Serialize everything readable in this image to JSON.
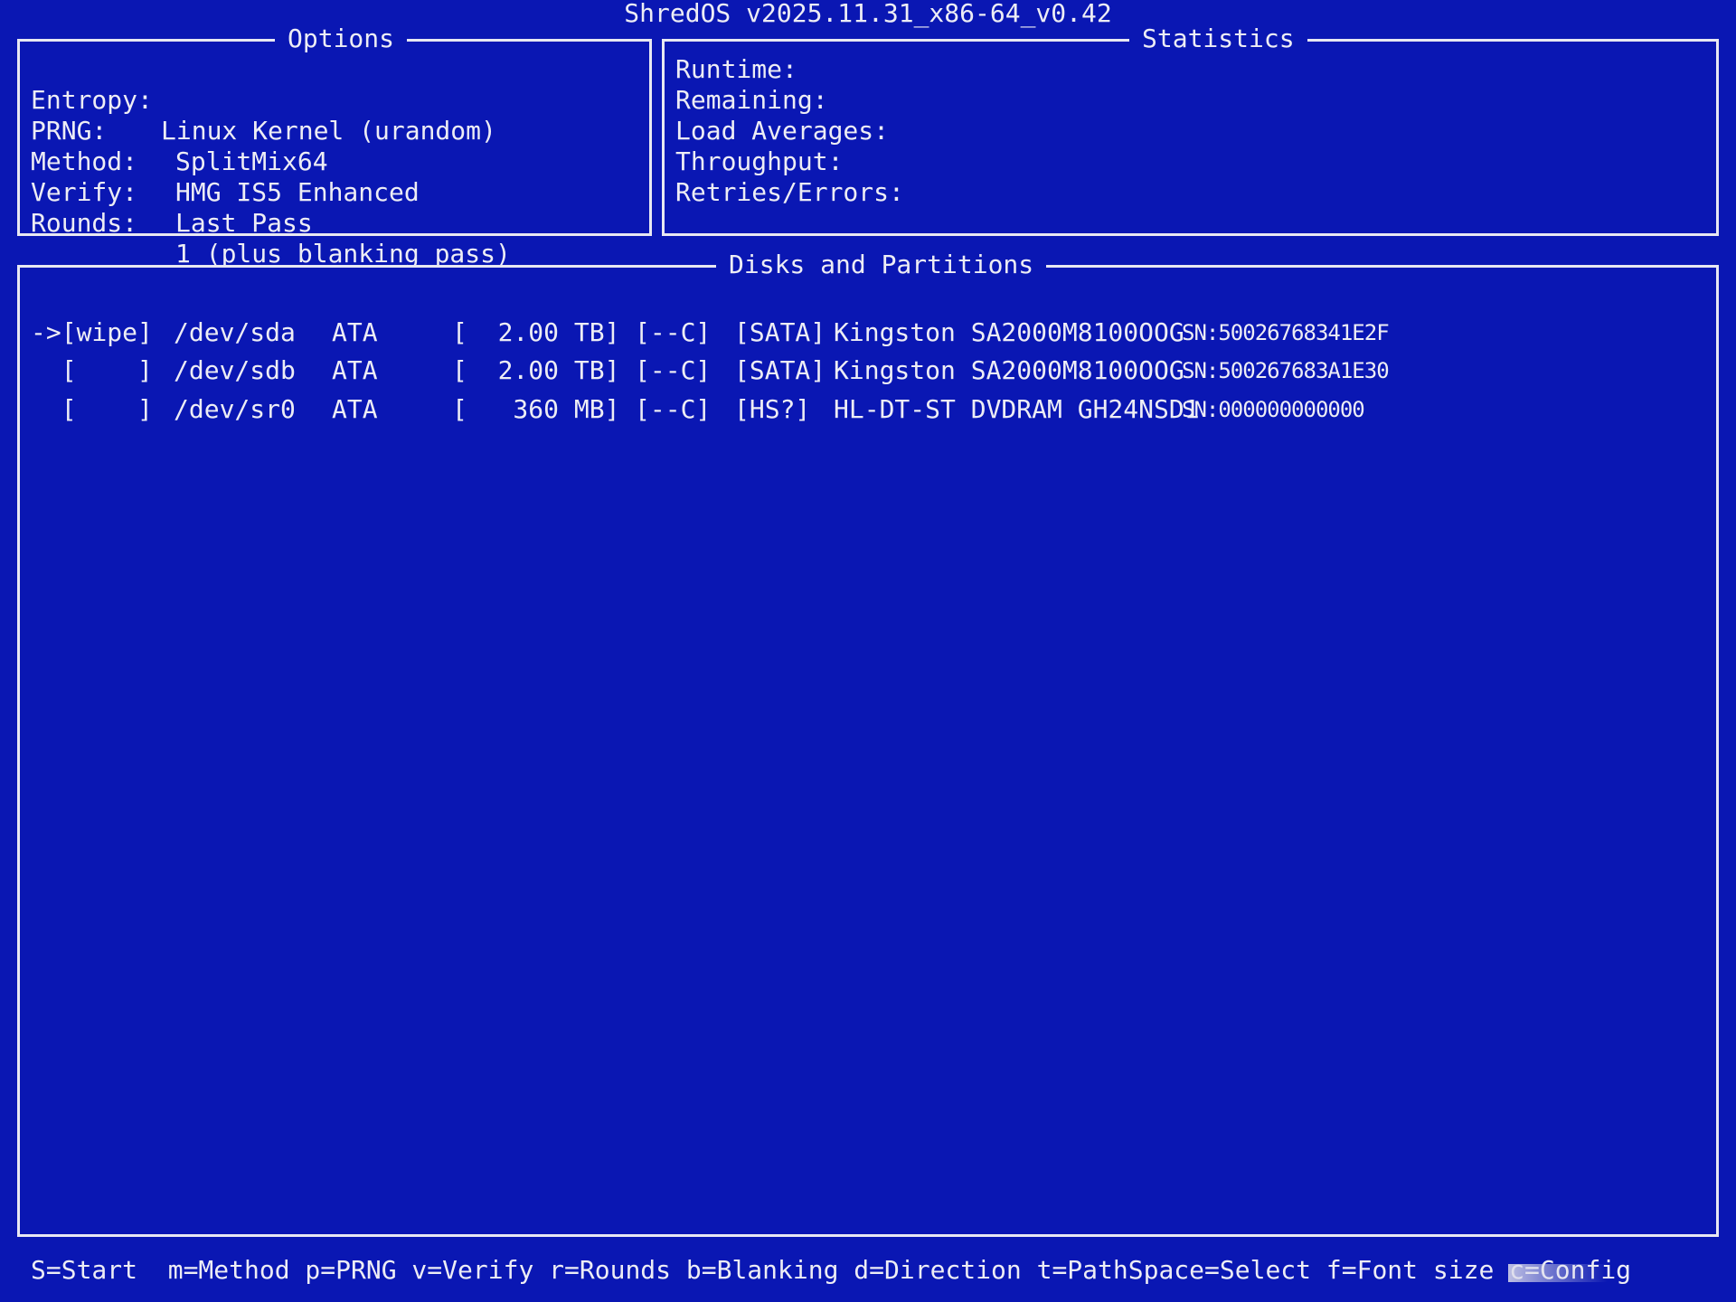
{
  "app": {
    "title": "ShredOS v2025.11.31_x86-64_v0.42"
  },
  "options": {
    "title": "Options",
    "rows": [
      {
        "key": "Entropy:",
        "value": "Linux Kernel (urandom)"
      },
      {
        "key": "PRNG:",
        "value": "SplitMix64"
      },
      {
        "key": "Method:",
        "value": "HMG IS5 Enhanced"
      },
      {
        "key": "Verify:",
        "value": "Last Pass"
      },
      {
        "key": "Rounds:",
        "value": "1 (plus blanking pass)"
      }
    ]
  },
  "statistics": {
    "title": "Statistics",
    "rows": [
      "Runtime:",
      "Remaining:",
      "Load Averages:",
      "Throughput:",
      "Retries/Errors:"
    ]
  },
  "disks": {
    "title": "Disks and Partitions",
    "rows": [
      {
        "selector": "->[wipe]",
        "device": "/dev/sda",
        "bus": "ATA",
        "size": "[  2.00 TB]",
        "flags": "[--C]",
        "iface": "[SATA]",
        "model": "Kingston SA2000M8100OOG",
        "serial": "SN:50026768341E2F"
      },
      {
        "selector": "  [    ]",
        "device": "/dev/sdb",
        "bus": "ATA",
        "size": "[  2.00 TB]",
        "flags": "[--C]",
        "iface": "[SATA]",
        "model": "Kingston SA2000M8100OOG",
        "serial": "SN:500267683A1E30"
      },
      {
        "selector": "  [    ]",
        "device": "/dev/sr0",
        "bus": "ATA",
        "size": "[   360 MB]",
        "flags": "[--C]",
        "iface": "[HS?]",
        "model": "HL-DT-ST DVDRAM GH24NSD1",
        "serial": "SN:000000000000"
      }
    ]
  },
  "footer": {
    "keys": "S=Start  m=Method p=PRNG v=Verify r=Rounds b=Blanking d=Direction t=PathSpace=Select f=Font size c=Config"
  },
  "colors": {
    "background": "#0a17b3",
    "foreground": "#ededf5"
  }
}
